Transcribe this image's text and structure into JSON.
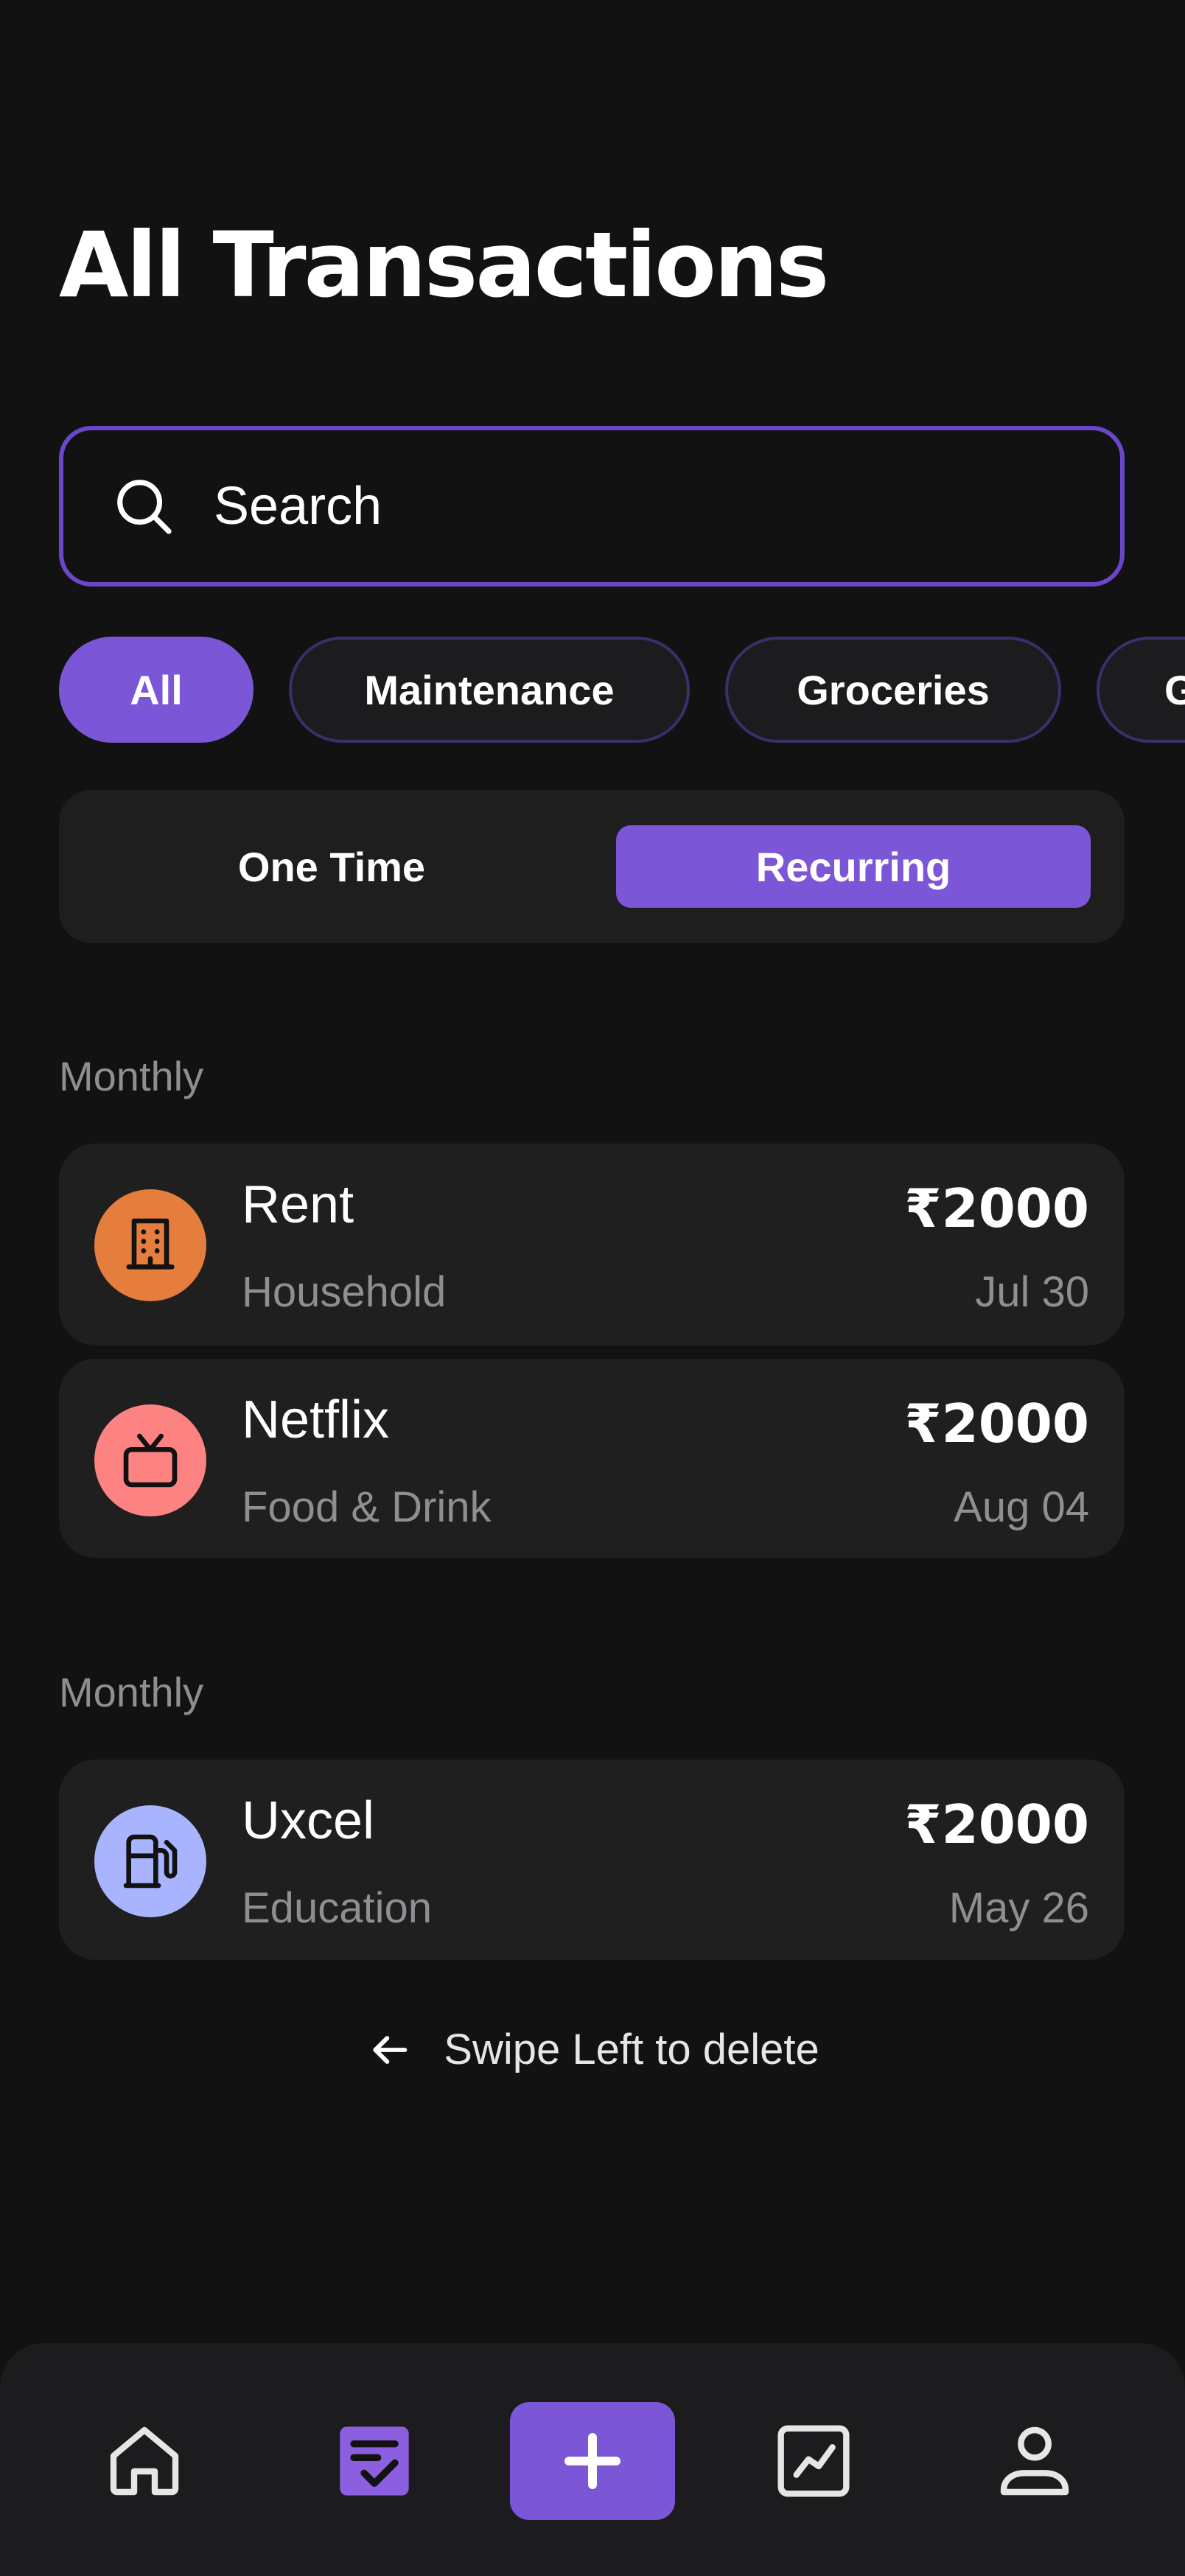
{
  "header": {
    "title": "All Transactions"
  },
  "search": {
    "placeholder": "Search"
  },
  "filters": {
    "chips": [
      {
        "label": "All",
        "active": true
      },
      {
        "label": "Maintenance",
        "active": false
      },
      {
        "label": "Groceries",
        "active": false
      },
      {
        "label": "G",
        "active": false
      }
    ]
  },
  "segment": {
    "one_time": "One Time",
    "recurring": "Recurring",
    "selected": "Recurring"
  },
  "groups": [
    {
      "label": "Monthly",
      "items": [
        {
          "name": "Rent",
          "category": "Household",
          "amount": "₹2000",
          "date": "Jul 30",
          "icon": "building-icon",
          "color": "#e57d3c"
        },
        {
          "name": "Netflix",
          "category": "Food & Drink",
          "amount": "₹2000",
          "date": "Aug 04",
          "icon": "tv-icon",
          "color": "#fd8282"
        }
      ]
    },
    {
      "label": "Monthly",
      "items": [
        {
          "name": "Uxcel",
          "category": "Education",
          "amount": "₹2000",
          "date": "May 26",
          "icon": "fuel-pump-icon",
          "color": "#a9b4ff"
        }
      ]
    }
  ],
  "hint": {
    "text": "Swipe Left to delete"
  },
  "colors": {
    "accent": "#7b56d6",
    "background": "#121212",
    "card": "#1f1f1f",
    "muted": "#8e8e93"
  },
  "nav": {
    "items": [
      "home-icon",
      "transactions-icon",
      "add-icon",
      "stats-icon",
      "profile-icon"
    ],
    "active": "transactions-icon"
  }
}
